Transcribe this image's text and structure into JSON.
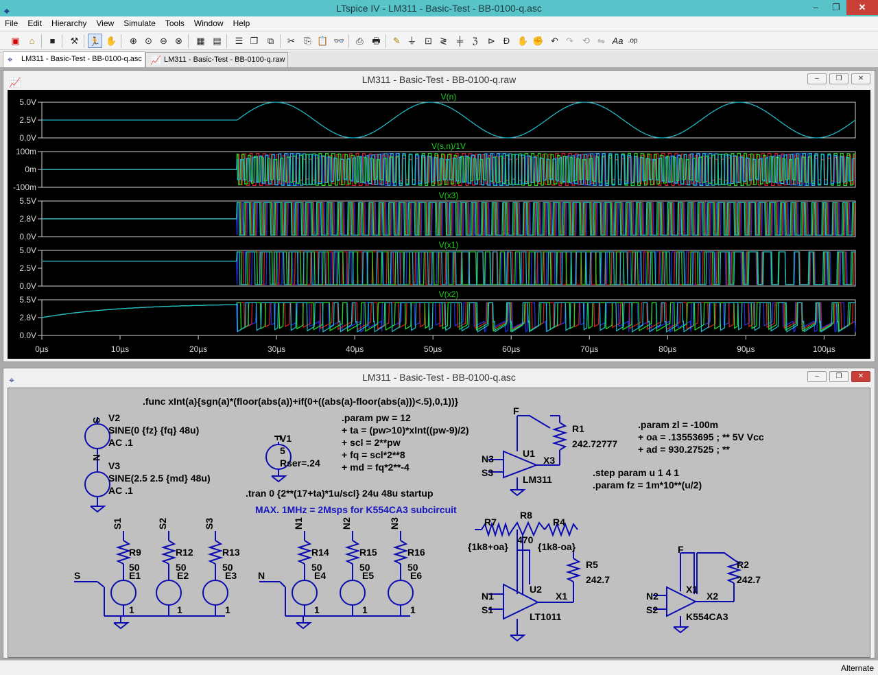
{
  "window": {
    "title": "LTspice IV - LM311 - Basic-Test - BB-0100-q.asc",
    "minimize": "–",
    "restore": "❐",
    "close": "✕"
  },
  "menu": [
    "File",
    "Edit",
    "Hierarchy",
    "View",
    "Simulate",
    "Tools",
    "Window",
    "Help"
  ],
  "tabs": [
    {
      "label": "LM311 - Basic-Test - BB-0100-q.asc"
    },
    {
      "label": "LM311 - Basic-Test - BB-0100-q.raw"
    }
  ],
  "waveform_window": {
    "title": "LM311 - Basic-Test - BB-0100-q.raw",
    "panes": [
      {
        "title": "V(n)",
        "ticks": [
          "5.0V",
          "2.5V",
          "0.0V"
        ]
      },
      {
        "title": "V(s,n)/1V",
        "ticks": [
          "100m",
          "0m",
          "-100m"
        ]
      },
      {
        "title": "V(x3)",
        "ticks": [
          "5.5V",
          "2.8V",
          "0.0V"
        ]
      },
      {
        "title": "V(x1)",
        "ticks": [
          "5.0V",
          "2.5V",
          "0.0V"
        ]
      },
      {
        "title": "V(x2)",
        "ticks": [
          "5.5V",
          "2.8V",
          "0.0V"
        ]
      }
    ],
    "x_ticks": [
      "0µs",
      "10µs",
      "20µs",
      "30µs",
      "40µs",
      "50µs",
      "60µs",
      "70µs",
      "80µs",
      "90µs",
      "100µs"
    ],
    "colors": {
      "background": "#000000",
      "trace1": "#20b7c8",
      "trace2": "#25d625",
      "trace3": "#2030e0",
      "trace4": "#d02020",
      "title": "#20d020"
    }
  },
  "schematic_window": {
    "title": "LM311 - Basic-Test - BB-0100-q.asc",
    "directives": {
      "func": ".func xInt(a){sgn(a)*(floor(abs(a))+if(0+((abs(a)-floor(abs(a)))<.5),0,1))}",
      "param1": [
        ".param pw = 12",
        "+ ta = (pw>10)*xInt((pw-9)/2)",
        "+ scl = 2**pw",
        "+ fq = scl*2**8",
        "+ md = fq*2**-4"
      ],
      "param2": [
        ".param zl = -100m",
        "+ oa = .13553695 ; ** 5V Vcc",
        "+ ad = 930.27525 ; **"
      ],
      "step": [
        ".step param u 1 4 1",
        ".param fz = 1m*10**(u/2)"
      ],
      "tran": ".tran 0 {2**(17+ta)*1u/scl} 24u 48u startup",
      "comment": "MAX. 1MHz = 2Msps for K554CA3 subcircuit"
    },
    "sources": {
      "V2": {
        "name": "V2",
        "lines": [
          "SINE(0 {fz} {fq} 48u)",
          "AC .1"
        ],
        "node": "S"
      },
      "V3": {
        "name": "V3",
        "lines": [
          "SINE(2.5 2.5 {md} 48u)",
          "AC .1"
        ],
        "node": "N"
      },
      "V1": {
        "name": "V1",
        "value": "5",
        "rser": "Rser=.24",
        "node": "F"
      }
    },
    "labels": {
      "F": "F",
      "N3": "N3",
      "S3": "S3",
      "U1": "U1",
      "X3": "X3",
      "LM311": "LM311",
      "R1": "R1",
      "R1v": "242.72777",
      "R7": "R7",
      "R8": "R8",
      "R4": "R4",
      "R8v": "470",
      "R7v": "{1k8+oa}",
      "R4v": "{1k8-oa}",
      "R5": "R5",
      "R5v": "242.7",
      "N1": "N1",
      "S1": "S1",
      "U2": "U2",
      "X1": "X1",
      "LT1011": "LT1011",
      "R2": "R2",
      "R2v": "242.7",
      "N2": "N2",
      "S2": "S2",
      "X1b": "X1",
      "X2": "X2",
      "K554CA3": "K554CA3",
      "S": "S",
      "N": "N",
      "S1n": "S1",
      "S2n": "S2",
      "S3n": "S3",
      "N1n": "N1",
      "N2n": "N2",
      "N3n": "N3",
      "R9": "R9",
      "R12": "R12",
      "R13": "R13",
      "R14": "R14",
      "R15": "R15",
      "R16": "R16",
      "r50": "50",
      "E1": "E1",
      "E2": "E2",
      "E3": "E3",
      "E4": "E4",
      "E5": "E5",
      "E6": "E6",
      "one": "1"
    }
  },
  "status": {
    "text": "Alternate"
  }
}
